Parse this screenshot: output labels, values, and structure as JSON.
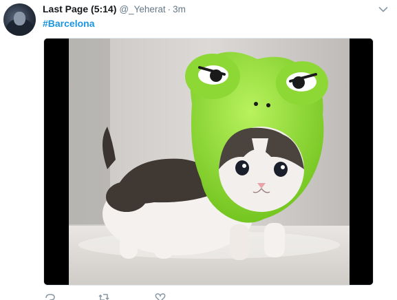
{
  "tweet": {
    "author_name": "Last Page (5:14)",
    "handle": "@_Yeherat",
    "separator": "·",
    "timestamp": "3m",
    "hashtag": "#Barcelona",
    "accent_color": "#1b95e0",
    "media_icon": "photo",
    "actions": [
      {
        "icon": "reply-icon"
      },
      {
        "icon": "retweet-icon"
      },
      {
        "icon": "like-icon"
      }
    ]
  }
}
